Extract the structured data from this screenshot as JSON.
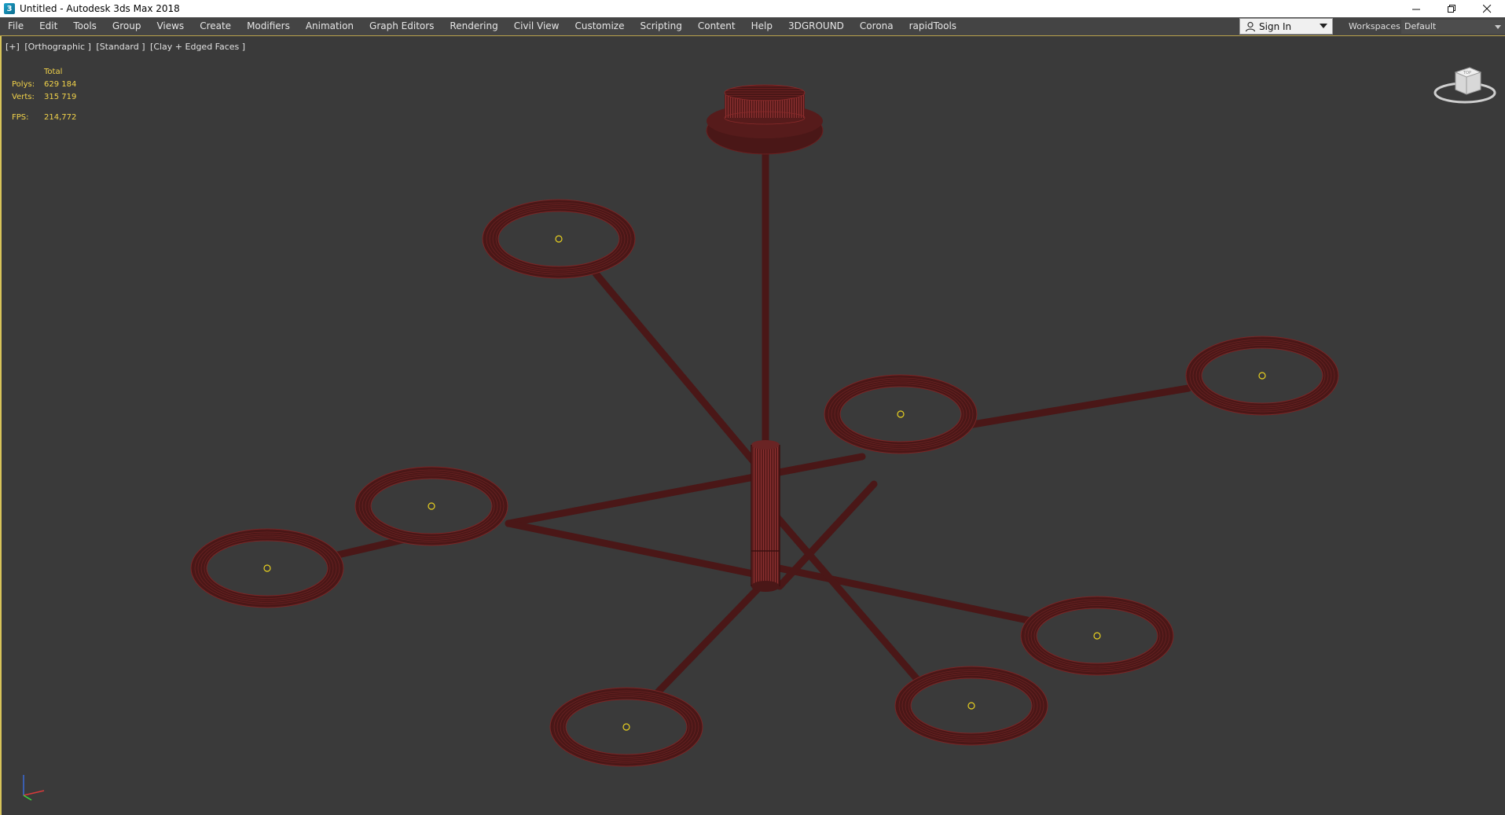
{
  "title_bar": {
    "title": "Untitled - Autodesk 3ds Max 2018",
    "app_icon": "3ds-max-logo-icon",
    "controls": [
      "minimize-icon",
      "restore-icon",
      "close-icon"
    ]
  },
  "menu": {
    "items": [
      "File",
      "Edit",
      "Tools",
      "Group",
      "Views",
      "Create",
      "Modifiers",
      "Animation",
      "Graph Editors",
      "Rendering",
      "Civil View",
      "Customize",
      "Scripting",
      "Content",
      "Help",
      "3DGROUND",
      "Corona",
      "rapidTools"
    ],
    "sign_in": "Sign In",
    "workspaces_label": "Workspaces:",
    "workspace": "Default"
  },
  "viewport": {
    "labels": [
      "[+]",
      "[Orthographic ]",
      "[Standard ]",
      "[Clay + Edged Faces ]"
    ],
    "stats": {
      "total_label": "Total",
      "polys_label": "Polys:",
      "polys_value": "629 184",
      "verts_label": "Verts:",
      "verts_value": "315 719",
      "fps_label": "FPS:",
      "fps_value": "214,772"
    },
    "colors": {
      "background": "#3a3a3a",
      "model": "#4a1717",
      "wire": "#8a2a2a",
      "highlight": "#b84848",
      "stats_text": "#f2d34a",
      "light_marker": "#e8d020",
      "active_border": "#d7c45a"
    },
    "icons": [
      "viewcube-icon",
      "axis-tripod-icon"
    ]
  }
}
